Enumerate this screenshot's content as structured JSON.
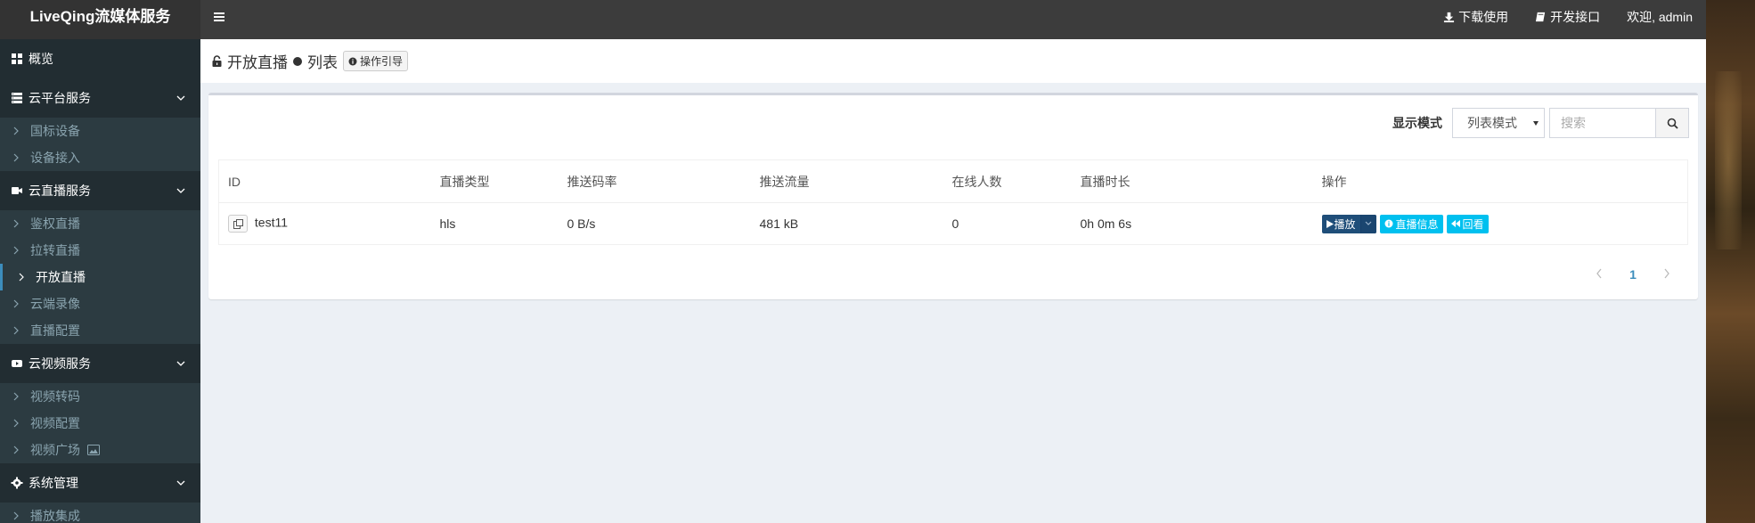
{
  "header": {
    "brand": "LiveQing流媒体服务",
    "nav": {
      "download": "下载使用",
      "api": "开发接口",
      "user": "欢迎, admin"
    }
  },
  "sidebar": {
    "overview": "概览",
    "cloud_platform": {
      "label": "云平台服务",
      "items": [
        "国标设备",
        "设备接入"
      ]
    },
    "live": {
      "label": "云直播服务",
      "items": [
        "鉴权直播",
        "拉转直播",
        "开放直播",
        "云端录像",
        "直播配置"
      ],
      "active": "开放直播"
    },
    "video": {
      "label": "云视频服务",
      "items": [
        "视频转码",
        "视频配置",
        "视频广场"
      ]
    },
    "system": {
      "label": "系统管理",
      "items": [
        "播放集成"
      ]
    }
  },
  "page": {
    "title": "开放直播",
    "subtitle": "列表",
    "guide_label": "操作引导"
  },
  "toolbar": {
    "mode_label": "显示模式",
    "mode_value": "列表模式",
    "search_placeholder": "搜索"
  },
  "table": {
    "columns": [
      "ID",
      "直播类型",
      "推送码率",
      "推送流量",
      "在线人数",
      "直播时长",
      "操作"
    ],
    "rows": [
      {
        "id": "test11",
        "type": "hls",
        "bitrate": "0 B/s",
        "traffic": "481 kB",
        "online": "0",
        "duration": "0h 0m 6s"
      }
    ],
    "actions": {
      "play": "播放",
      "info": "直播信息",
      "replay": "回看"
    }
  },
  "pagination": {
    "current": "1"
  },
  "colors": {
    "header_bg": "#3c3c3c",
    "sidebar_bg": "#222d32",
    "primary": "#1f4e79",
    "info": "#00c0ef",
    "link": "#3c8dbc"
  }
}
